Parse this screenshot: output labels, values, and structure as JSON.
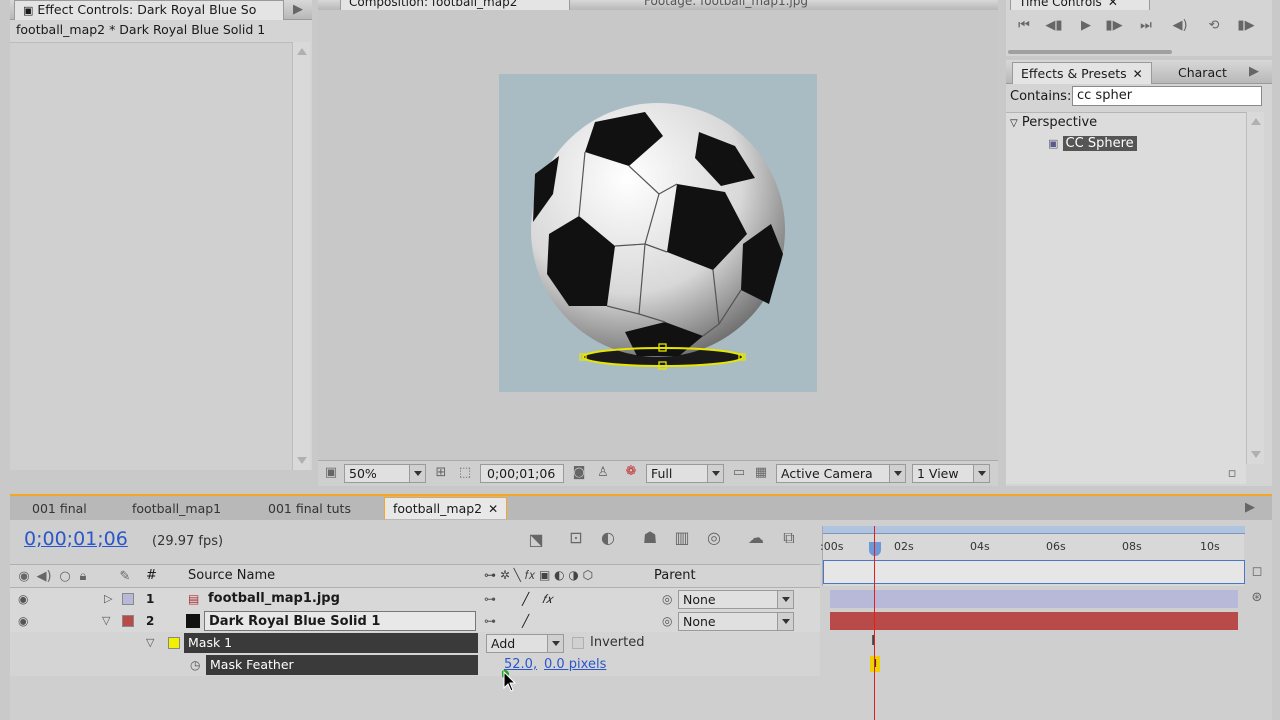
{
  "effect_controls": {
    "tab_label": "Effect Controls: Dark Royal Blue So",
    "header": "football_map2 * Dark Royal Blue Solid 1"
  },
  "composition": {
    "tab_label": "Composition: football_map2",
    "footage_tab_label": "Footage: football_map1.jpg",
    "zoom": "50%",
    "timecode": "0;00;01;06",
    "resolution": "Full",
    "camera": "Active Camera",
    "views": "1 View"
  },
  "time_controls": {
    "tab_label": "Time Controls"
  },
  "effects_presets": {
    "tab_label": "Effects & Presets",
    "character_tab_label": "Charact",
    "contains_label": "Contains:",
    "search_value": "cc spher",
    "folder": "Perspective",
    "item": "CC Sphere"
  },
  "timeline": {
    "tabs": [
      "001 final",
      "football_map1",
      "001 final tuts",
      "football_map2"
    ],
    "timecode": "0;00;01;06",
    "fps": "(29.97 fps)",
    "columns": {
      "number": "#",
      "source_name": "Source Name",
      "parent": "Parent"
    },
    "ruler": [
      ":00s",
      "02s",
      "04s",
      "06s",
      "08s",
      "10s"
    ],
    "layers": [
      {
        "number": "1",
        "name": "football_map1.jpg",
        "parent": "None"
      },
      {
        "number": "2",
        "name": "Dark Royal Blue Solid 1",
        "parent": "None"
      }
    ],
    "mask": {
      "name": "Mask 1",
      "mode": "Add",
      "inverted": "Inverted"
    },
    "mask_feather": {
      "name": "Mask Feather",
      "value_x": "52.0,",
      "value_y": "0.0 pixels"
    }
  },
  "colors": {
    "accent_orange": "#f5a623",
    "timecode_blue": "#2b57c9",
    "layer1_bar": "#b8b8d8",
    "layer2_bar": "#b84a4a",
    "playhead": "#e02020"
  }
}
